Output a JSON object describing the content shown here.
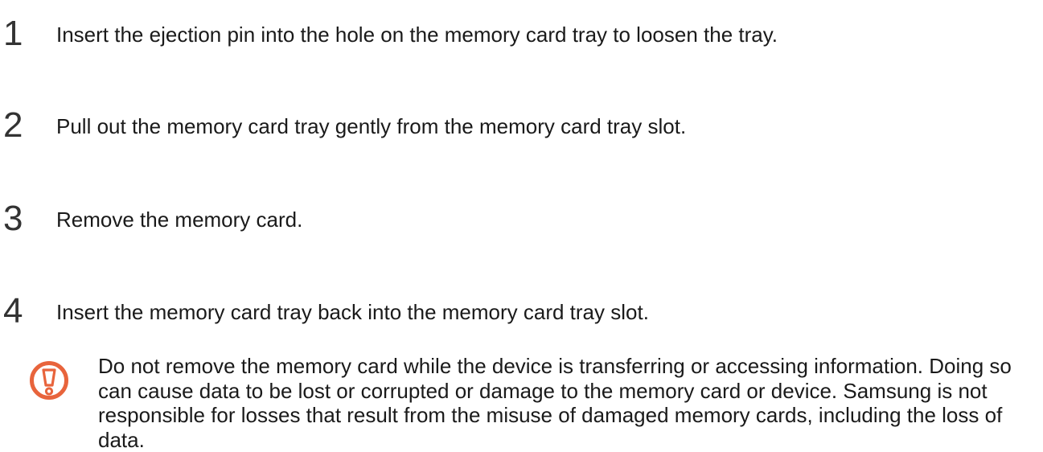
{
  "steps": [
    {
      "number": "1",
      "text": "Insert the ejection pin into the hole on the memory card tray to loosen the tray."
    },
    {
      "number": "2",
      "text": "Pull out the memory card tray gently from the memory card tray slot."
    },
    {
      "number": "3",
      "text": "Remove the memory card."
    },
    {
      "number": "4",
      "text": "Insert the memory card tray back into the memory card tray slot."
    }
  ],
  "caution": {
    "icon": "caution-exclamation-icon",
    "icon_color": "#e8643c",
    "text": "Do not remove the memory card while the device is transferring or accessing information. Doing so can cause data to be lost or corrupted or damage to the memory card or device. Samsung is not responsible for losses that result from the misuse of damaged memory cards, including the loss of data."
  }
}
